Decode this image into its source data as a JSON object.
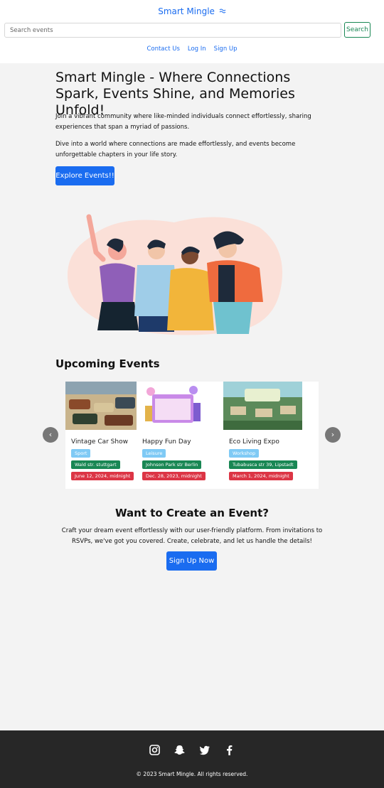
{
  "header": {
    "brand": "Smart Mingle",
    "brand_icon": "wave-icon",
    "search": {
      "placeholder": "Search events",
      "button_label": "Search"
    },
    "nav": [
      "Contact Us",
      "Log In",
      "Sign Up"
    ]
  },
  "hero": {
    "title": "Smart Mingle - Where Connections Spark, Events Shine, and Memories Unfold!",
    "paragraph1": "Join a vibrant community where like-minded individuals connect effortlessly, sharing experiences that span a myriad of passions.",
    "paragraph2": "Dive into a world where connections are made effortlessly, and events become unforgettable chapters in your life story.",
    "cta_label": "Explore Events!!"
  },
  "upcoming": {
    "title": "Upcoming Events",
    "events": [
      {
        "name": "Vintage Car Show",
        "category": "Sport",
        "location": "Wald str. stuttgart",
        "date": "June 12, 2024, midnight"
      },
      {
        "name": "Happy Fun Day",
        "category": "Leisure",
        "location": "Johnson Park str Berlin",
        "date": "Dec. 28, 2023, midnight"
      },
      {
        "name": "Eco Living Expo",
        "category": "Workshop",
        "location": "Tubabusca str 39, Lipstadt",
        "date": "March 1, 2024, midnight"
      }
    ]
  },
  "create": {
    "title": "Want to Create an Event?",
    "paragraph": "Craft your dream event effortlessly with our user-friendly platform. From invitations to RSVPs, we've got you covered. Create, celebrate, and let us handle the details!",
    "button_label": "Sign Up Now"
  },
  "footer": {
    "social": [
      "instagram-icon",
      "snapchat-icon",
      "twitter-icon",
      "facebook-icon"
    ],
    "copyright": "© 2023 Smart Mingle. All rights reserved."
  },
  "colors": {
    "primary": "#1a6cf0",
    "success": "#198754",
    "danger": "#dc3545",
    "info": "#7fcaf5",
    "footer": "#272727"
  }
}
